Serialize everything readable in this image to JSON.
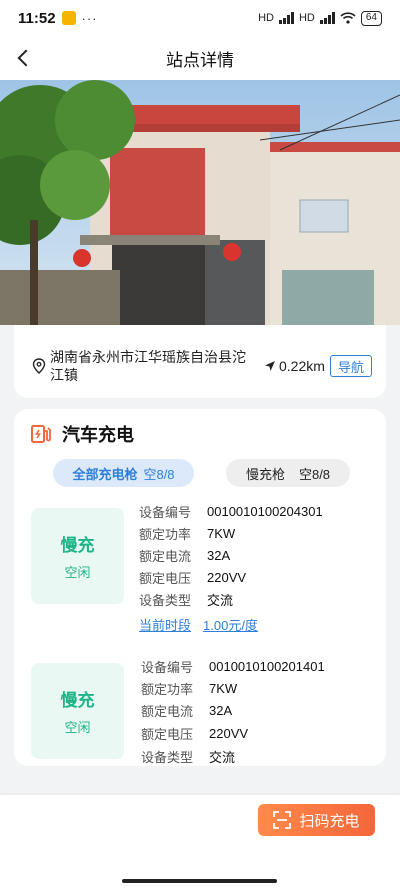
{
  "status_bar": {
    "time": "11:52",
    "dots": "···",
    "net1": "HD",
    "net2": "HD",
    "battery": "64"
  },
  "nav": {
    "title": "站点详情"
  },
  "station": {
    "address": "湖南省永州市江华瑶族自治县沱江镇",
    "distance": "0.22km",
    "navigate_label": "导航"
  },
  "charging": {
    "section_title": "汽车充电",
    "tabs": [
      {
        "label": "全部充电枪",
        "count": "空8/8"
      },
      {
        "label": "慢充枪",
        "count": "空8/8"
      }
    ],
    "devices": [
      {
        "type": "慢充",
        "status": "空闲",
        "specs": [
          {
            "key": "设备编号",
            "value": "0010010100204301"
          },
          {
            "key": "额定功率",
            "value": "7KW"
          },
          {
            "key": "额定电流",
            "value": "32A"
          },
          {
            "key": "额定电压",
            "value": "220VV"
          },
          {
            "key": "设备类型",
            "value": "交流"
          }
        ],
        "tariff_label": "当前时段",
        "tariff_value": "1.00元/度"
      },
      {
        "type": "慢充",
        "status": "空闲",
        "specs": [
          {
            "key": "设备编号",
            "value": "0010010100201401"
          },
          {
            "key": "额定功率",
            "value": "7KW"
          },
          {
            "key": "额定电流",
            "value": "32A"
          },
          {
            "key": "额定电压",
            "value": "220VV"
          },
          {
            "key": "设备类型",
            "value": "交流"
          }
        ]
      }
    ]
  },
  "scan_button": {
    "label": "扫码充电"
  },
  "colors": {
    "accent_blue": "#2f7fd8",
    "accent_green": "#1fb488",
    "accent_orange": "#f4663b"
  },
  "icons": {
    "back": "chevron-left-icon",
    "location": "location-pin-icon",
    "distance": "navigation-arrow-icon",
    "charger": "charging-station-icon",
    "scan": "scan-frame-icon"
  }
}
